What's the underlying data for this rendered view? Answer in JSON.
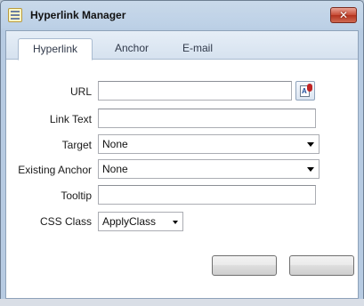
{
  "window": {
    "title": "Hyperlink Manager",
    "close_glyph": "✕"
  },
  "tabs": [
    {
      "label": "Hyperlink",
      "active": true
    },
    {
      "label": "Anchor",
      "active": false
    },
    {
      "label": "E-mail",
      "active": false
    }
  ],
  "form": {
    "url": {
      "label": "URL",
      "value": ""
    },
    "link_text": {
      "label": "Link Text",
      "value": ""
    },
    "target": {
      "label": "Target",
      "selected": "None"
    },
    "existing_anchor": {
      "label": "Existing Anchor",
      "selected": "None"
    },
    "tooltip": {
      "label": "Tooltip",
      "value": ""
    },
    "css_class": {
      "label": "CSS Class",
      "selected": "ApplyClass"
    }
  },
  "buttons": {
    "ok_label": "",
    "cancel_label": ""
  },
  "colors": {
    "accent_close": "#c84b35",
    "title_bar": "#c9d9ea"
  }
}
